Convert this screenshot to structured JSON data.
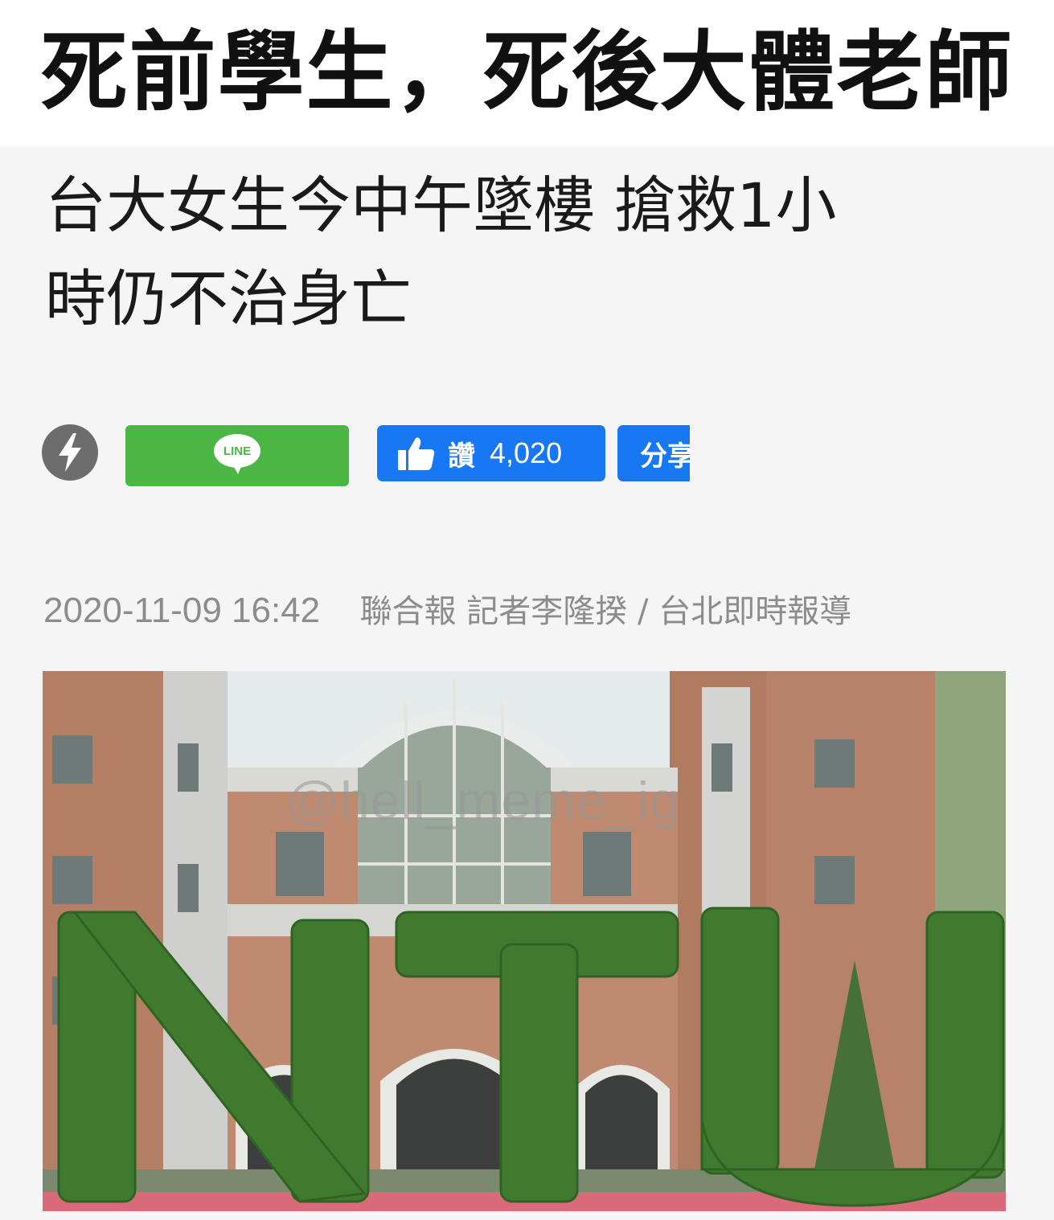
{
  "meme": {
    "caption": "死前學生，死後大體老師"
  },
  "article": {
    "headline_line1": "台大女生今中午墜樓 搶救1小",
    "headline_line2": "時仍不治身亡",
    "date": "2020-11-09 16:42",
    "source": "聯合報 記者李隆揆 / 台北即時報導"
  },
  "share_bar": {
    "amp_icon": "lightning-bolt-icon",
    "line_label": "LINE",
    "like_label": "讚",
    "like_count": "4,020",
    "share_label": "分享"
  },
  "photo": {
    "letters": "NTU",
    "watermark": "@hell_meme_ig"
  },
  "colors": {
    "line_green": "#4cb645",
    "facebook_blue": "#1877f2",
    "byline_gray": "#8c8c8c"
  }
}
